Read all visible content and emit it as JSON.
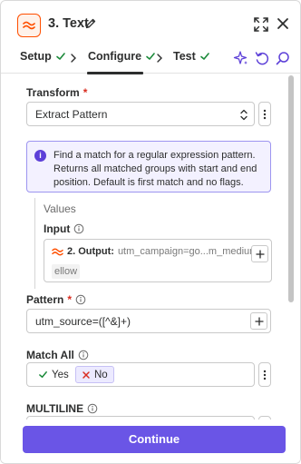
{
  "header": {
    "title": "3. Text",
    "app_icon": "text-formatter-icon",
    "accent_color": "#ff4f00"
  },
  "tabs": [
    {
      "label": "Setup",
      "complete": true
    },
    {
      "label": "Configure",
      "complete": true,
      "active": true
    },
    {
      "label": "Test",
      "complete": true
    }
  ],
  "toolbar": {
    "icons": [
      "sparkle-icon",
      "undo-icon",
      "search-icon"
    ]
  },
  "form": {
    "transform": {
      "label": "Transform",
      "required_mark": "*",
      "value": "Extract Pattern"
    },
    "info": {
      "text": "Find a match for a regular expression pattern. Returns all matched groups with start and end position. Default is first match and no flags."
    },
    "values": {
      "title": "Values",
      "input_label": "Input",
      "mapped_step": "2. Output:",
      "mapped_preview": "utm_campaign=go...m_medium=y",
      "mapped_overflow": "ellow"
    },
    "pattern": {
      "label": "Pattern",
      "required_mark": "*",
      "value": "utm_source=([^&]+)"
    },
    "match_all": {
      "label": "Match All",
      "yes": "Yes",
      "no": "No",
      "selected": "No"
    },
    "multiline": {
      "label": "MULTILINE"
    }
  },
  "footer": {
    "continue_label": "Continue",
    "primary_color": "#6a55e6"
  }
}
